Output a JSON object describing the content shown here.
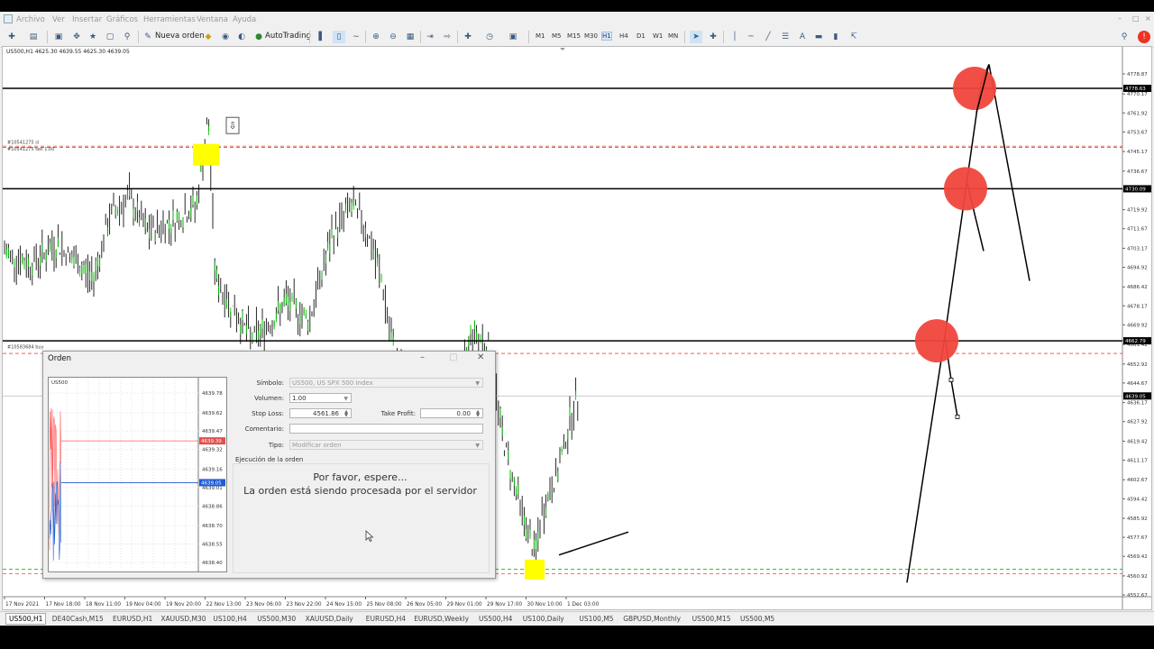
{
  "menu": {
    "items": [
      "Archivo",
      "Ver",
      "Insertar",
      "Gráficos",
      "Herramientas",
      "Ventana",
      "Ayuda"
    ]
  },
  "toolbar": {
    "new_order": "Nueva orden",
    "autotrading": "AutoTrading",
    "timeframes": [
      "M1",
      "M5",
      "M15",
      "M30",
      "H1",
      "H4",
      "D1",
      "W1",
      "MN"
    ],
    "active_timeframe": "H1"
  },
  "chart": {
    "info": "US500,H1  4625.30 4639.55 4625.30 4639.05",
    "order_label_sl": "#10541275 sl",
    "order_label_sell": "#10541275 sell 1.00",
    "order_label_2": "#10583684 buy",
    "price_axis": [
      "4778.87",
      "4770.17",
      "4761.92",
      "4753.67",
      "4745.17",
      "4736.67",
      "4728.42",
      "4719.92",
      "4711.67",
      "4703.17",
      "4694.92",
      "4686.42",
      "4678.17",
      "4669.92",
      "4661.42",
      "4652.92",
      "4644.67",
      "4636.17",
      "4627.92",
      "4619.42",
      "4611.17",
      "4602.67",
      "4594.42",
      "4585.92",
      "4577.67",
      "4569.42",
      "4560.92",
      "4552.67"
    ],
    "price_badges": {
      "top": "4778.63",
      "mid_top": "4730.09",
      "mid": "4662.79",
      "current": "4639.05"
    },
    "time_axis": [
      "17 Nov 2021",
      "17 Nov 18:00",
      "18 Nov 11:00",
      "19 Nov 04:00",
      "19 Nov 20:00",
      "22 Nov 13:00",
      "23 Nov 06:00",
      "23 Nov 22:00",
      "24 Nov 15:00",
      "25 Nov 08:00",
      "26 Nov 05:00",
      "29 Nov 01:00",
      "29 Nov 17:00",
      "30 Nov 10:00",
      "1 Dec 03:00"
    ],
    "colors": {
      "annotation_red": "#f0463c",
      "highlight_yellow": "#ffff00",
      "sl_red": "#ff5a5a",
      "tp_green": "#00c800",
      "bid_blue": "#1f5bd6"
    }
  },
  "tabs": [
    "US500,H1",
    "DE40Cash,M15",
    "EURUSD,H1",
    "XAUUSD,M30",
    "US100,H4",
    "US500,M30",
    "XAUUSD,Daily",
    "EURUSD,H4",
    "EURUSD,Weekly",
    "US500,H4",
    "US100,Daily",
    "US100,M5",
    "GBPUSD,Monthly",
    "US500,M15",
    "US500,M5"
  ],
  "order_dialog": {
    "title": "Orden",
    "mini_chart_symbol": "US500",
    "mini_prices": [
      "4639.78",
      "4639.62",
      "4639.47",
      "4639.32",
      "4639.16",
      "4639.01",
      "4638.86",
      "4638.70",
      "4638.55",
      "4638.40"
    ],
    "mini_ask_badge": "4639.39",
    "mini_bid_badge": "4639.05",
    "symbol_label": "Símbolo:",
    "symbol_value": "US500, US SPX 500 Index",
    "volume_label": "Volumen:",
    "volume_value": "1.00",
    "sl_label": "Stop Loss:",
    "sl_value": "4561.86",
    "tp_label": "Take Profit:",
    "tp_value": "0.00",
    "comment_label": "Comentario:",
    "comment_value": "",
    "type_label": "Tipo:",
    "type_value": "Modificar orden",
    "execution_group": "Ejecución de la orden",
    "wait_msg": "Por favor, espere...",
    "processing_msg": "La orden está siendo procesada por el servidor"
  }
}
